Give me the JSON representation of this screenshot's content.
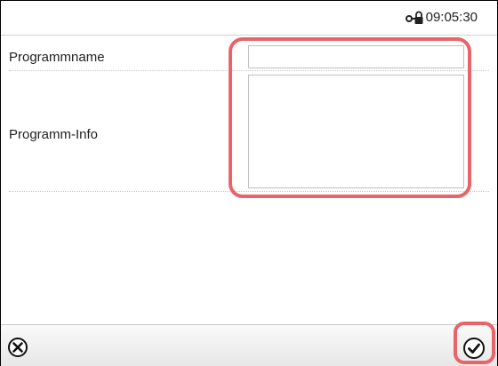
{
  "status_bar": {
    "time": "09:05:30",
    "lock_icon": "padlock-key-icon"
  },
  "form": {
    "program_name": {
      "label": "Programmname",
      "value": "",
      "placeholder": ""
    },
    "program_info": {
      "label": "Programm-Info",
      "value": "",
      "placeholder": ""
    }
  },
  "footer": {
    "cancel_icon": "cancel-circle-x-icon",
    "confirm_icon": "confirm-circle-check-icon"
  },
  "colors": {
    "highlight": "#e8646a",
    "border": "#bfbfbf"
  }
}
